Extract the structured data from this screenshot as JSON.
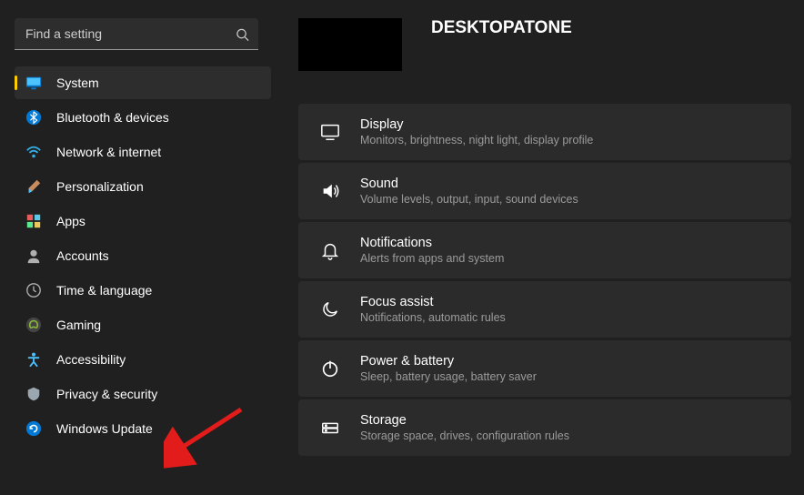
{
  "search": {
    "placeholder": "Find a setting"
  },
  "sidebar": {
    "items": [
      {
        "label": "System"
      },
      {
        "label": "Bluetooth & devices"
      },
      {
        "label": "Network & internet"
      },
      {
        "label": "Personalization"
      },
      {
        "label": "Apps"
      },
      {
        "label": "Accounts"
      },
      {
        "label": "Time & language"
      },
      {
        "label": "Gaming"
      },
      {
        "label": "Accessibility"
      },
      {
        "label": "Privacy & security"
      },
      {
        "label": "Windows Update"
      }
    ]
  },
  "header": {
    "pc_name": "DESKTOPATONE"
  },
  "cards": [
    {
      "title": "Display",
      "sub": "Monitors, brightness, night light, display profile"
    },
    {
      "title": "Sound",
      "sub": "Volume levels, output, input, sound devices"
    },
    {
      "title": "Notifications",
      "sub": "Alerts from apps and system"
    },
    {
      "title": "Focus assist",
      "sub": "Notifications, automatic rules"
    },
    {
      "title": "Power & battery",
      "sub": "Sleep, battery usage, battery saver"
    },
    {
      "title": "Storage",
      "sub": "Storage space, drives, configuration rules"
    }
  ]
}
